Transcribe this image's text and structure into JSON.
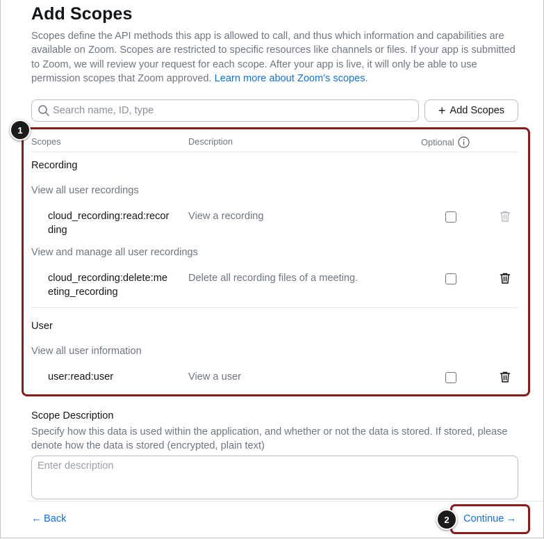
{
  "page": {
    "title": "Add Scopes",
    "intro_text": "Scopes define the API methods this app is allowed to call, and thus which information and capabilities are available on Zoom. Scopes are restricted to specific resources like channels or files. If your app is submitted to Zoom, we will review your request for each scope. After your app is live, it will only be able to use permission scopes that Zoom approved.",
    "intro_link": "Learn more about Zoom's scopes",
    "intro_end": "."
  },
  "search": {
    "placeholder": "Search name, ID, type",
    "value": ""
  },
  "add_button": {
    "label": "Add Scopes",
    "icon": "plus-icon"
  },
  "table": {
    "headers": {
      "scopes": "Scopes",
      "description": "Description",
      "optional": "Optional"
    },
    "groups": [
      {
        "title": "Recording",
        "subgroups": [
          {
            "label": "View all user recordings",
            "scopes": [
              {
                "name": "cloud_recording:read:recording",
                "description": "View a recording",
                "optional": false,
                "delete_enabled": false
              }
            ]
          },
          {
            "label": "View and manage all user recordings",
            "scopes": [
              {
                "name": "cloud_recording:delete:meeting_recording",
                "description": "Delete all recording files of a meeting.",
                "optional": false,
                "delete_enabled": true
              }
            ]
          }
        ]
      },
      {
        "title": "User",
        "subgroups": [
          {
            "label": "View all user information",
            "scopes": [
              {
                "name": "user:read:user",
                "description": "View a user",
                "optional": false,
                "delete_enabled": true
              }
            ]
          }
        ]
      }
    ]
  },
  "scope_description": {
    "title": "Scope Description",
    "help": "Specify how this data is used within the application, and whether or not the data is stored. If stored, please denote how the data is stored (encrypted, plain text)",
    "placeholder": "Enter description",
    "value": ""
  },
  "footer": {
    "back_label": "Back",
    "continue_label": "Continue"
  },
  "callouts": {
    "one": "1",
    "two": "2"
  },
  "colors": {
    "accent": "#0e72ed",
    "highlight": "#8b1a1a",
    "muted_text": "#6e7680"
  }
}
